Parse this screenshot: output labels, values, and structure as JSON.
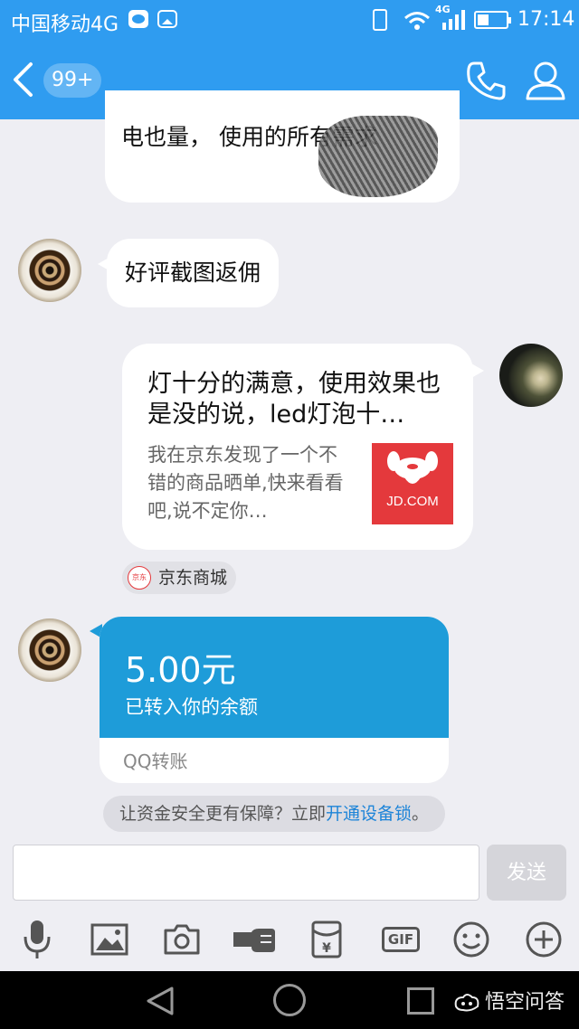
{
  "status_bar": {
    "carrier": "中国移动4G",
    "network_badge": "4G",
    "time": "17:14",
    "icons": [
      "wechat-icon",
      "gallery-icon",
      "vibrate-icon",
      "wifi-icon",
      "signal-icon",
      "battery-icon"
    ]
  },
  "nav": {
    "unread_count": "99+",
    "icons": [
      "back-chevron-icon",
      "phone-icon",
      "profile-icon"
    ]
  },
  "messages": {
    "m1_text": "电也量，   使用的所有需求",
    "m2_text": "好评截图返佣",
    "share_card": {
      "title": "灯十分的满意，使用效果也是没的说，led灯泡十…",
      "description": "我在京东发现了一个不错的商品晒单,快来看看吧,说不定你…",
      "logo_text": "JD.COM",
      "source_icon_text": "京东",
      "source_label": "京东商城"
    },
    "transfer": {
      "amount": "5.00元",
      "description": "已转入你的余额",
      "footer": "QQ转账"
    },
    "notice": {
      "text": "让资金安全更有保障？立即",
      "link": "开通设备锁",
      "end": "。"
    }
  },
  "composer": {
    "input_value": "",
    "send_label": "发送"
  },
  "toolbar": {
    "gif_label": "GIF",
    "icons": [
      "microphone-icon",
      "image-icon",
      "camera-icon",
      "hand-icon",
      "red-packet-icon",
      "gif-icon",
      "emoji-icon",
      "plus-icon"
    ]
  },
  "system_nav": {
    "watermark": "悟空问答"
  },
  "colors": {
    "header_blue": "#2f9cf0",
    "transfer_blue": "#1e9cd9",
    "link_blue": "#1d84d8",
    "jd_red": "#e4393c",
    "chat_bg": "#eeeef3"
  }
}
